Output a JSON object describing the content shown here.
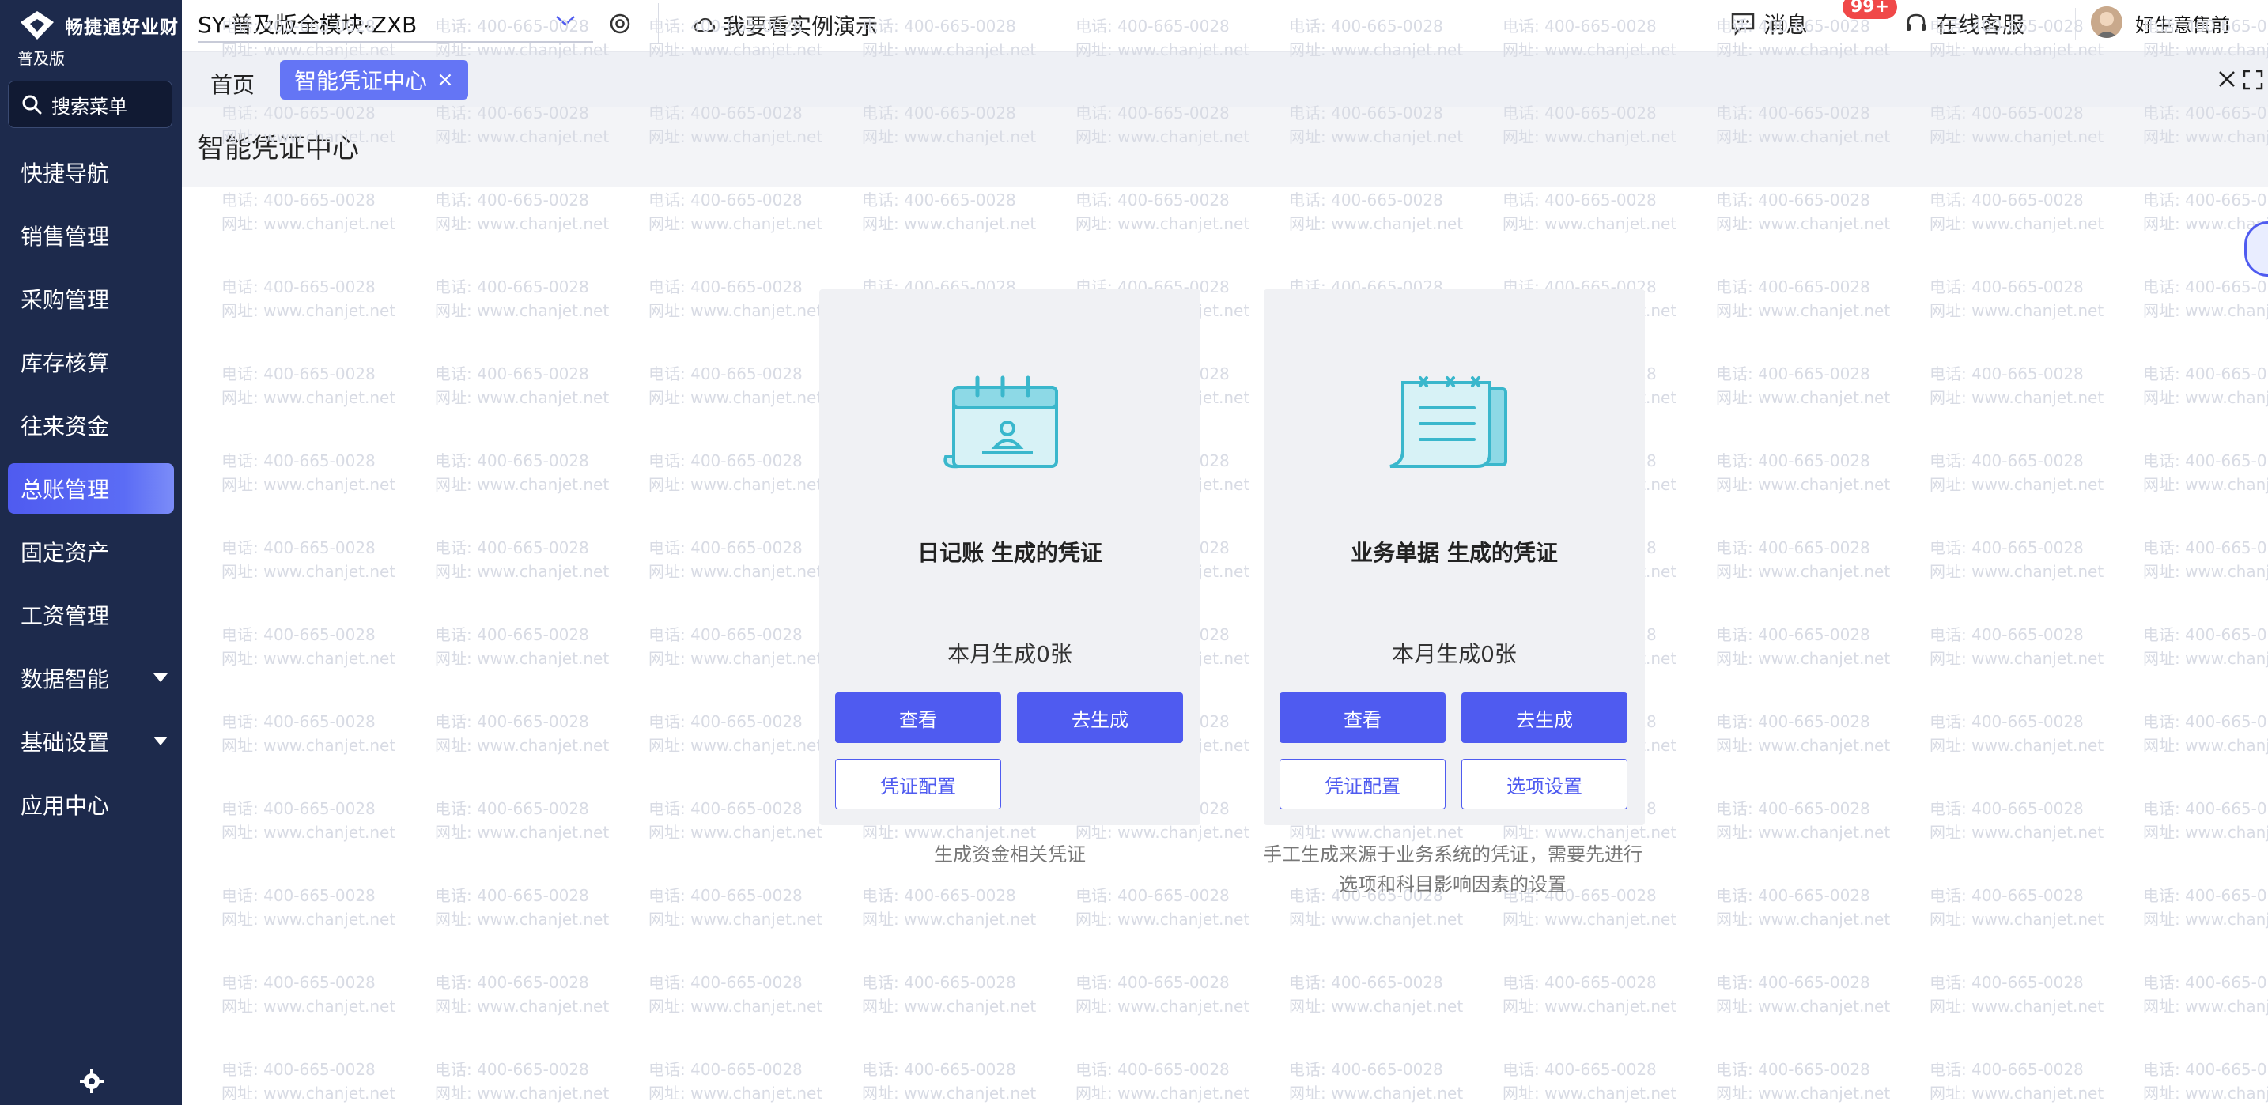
{
  "app": {
    "brand": "畅捷通好业财",
    "edition": "普及版",
    "search_label": "搜索菜单",
    "account_name": "SY-普及版全模块-ZXB"
  },
  "sidebar": {
    "items": [
      {
        "label": "快捷导航"
      },
      {
        "label": "销售管理"
      },
      {
        "label": "采购管理"
      },
      {
        "label": "库存核算"
      },
      {
        "label": "往来资金"
      },
      {
        "label": "总账管理"
      },
      {
        "label": "固定资产"
      },
      {
        "label": "工资管理"
      },
      {
        "label": "数据智能"
      },
      {
        "label": "基础设置"
      },
      {
        "label": "应用中心"
      }
    ],
    "active_index": 5
  },
  "header": {
    "demo_label": "我要看实例演示",
    "messages_label": "消息",
    "messages_badge": "99+",
    "service_label": "在线客服",
    "user_name": "好生意售前"
  },
  "tabs": {
    "home": "首页",
    "active": "智能凭证中心",
    "close_symbol": "×"
  },
  "page": {
    "title": "智能凭证中心"
  },
  "cards": [
    {
      "title": "日记账 生成的凭证",
      "count": "本月生成0张",
      "buttons": [
        "查看",
        "去生成",
        "凭证配置"
      ],
      "description": "生成资金相关凭证"
    },
    {
      "title": "业务单据 生成的凭证",
      "count": "本月生成0张",
      "buttons": [
        "查看",
        "去生成",
        "凭证配置",
        "选项设置"
      ],
      "description_line1": "手工生成来源于业务系统的凭证，需要先进行",
      "description_line2": "选项和科目影响因素的设置"
    }
  ],
  "colors": {
    "sidebar_bg": "#1d2a4c",
    "accent": "#4f5bf0",
    "tab_active": "#6475f5",
    "badge": "#f04848"
  }
}
